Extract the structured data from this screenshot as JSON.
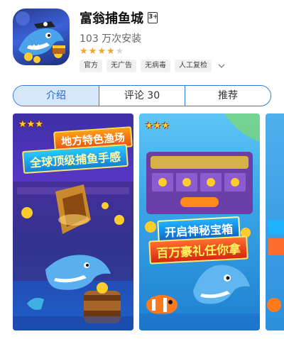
{
  "app": {
    "name": "富翁捕鱼城",
    "age_rating": "3+",
    "installs": "103 万次安装",
    "rating_stars": 4,
    "rating_max": 5
  },
  "tags": [
    "官方",
    "无广告",
    "无病毒",
    "人工复检"
  ],
  "tabs": [
    {
      "label": "介绍",
      "active": true
    },
    {
      "label": "评论 30",
      "active": false
    },
    {
      "label": "推荐",
      "active": false
    }
  ],
  "screenshots": [
    {
      "banner_top": "地方特色渔场",
      "banner_bottom": "全球顶级捕鱼手感"
    },
    {
      "banner_top": "开启神秘宝箱",
      "banner_bottom": "百万豪礼任你拿"
    }
  ],
  "icons": [
    "app-icon",
    "age-rating-icon",
    "star-icon",
    "chevron-down-icon"
  ],
  "colors": {
    "accent": "#1e6ad1",
    "star": "#f5a623",
    "star_empty": "#d6d6d6",
    "tab_active_bg": "#d7e7fb"
  }
}
